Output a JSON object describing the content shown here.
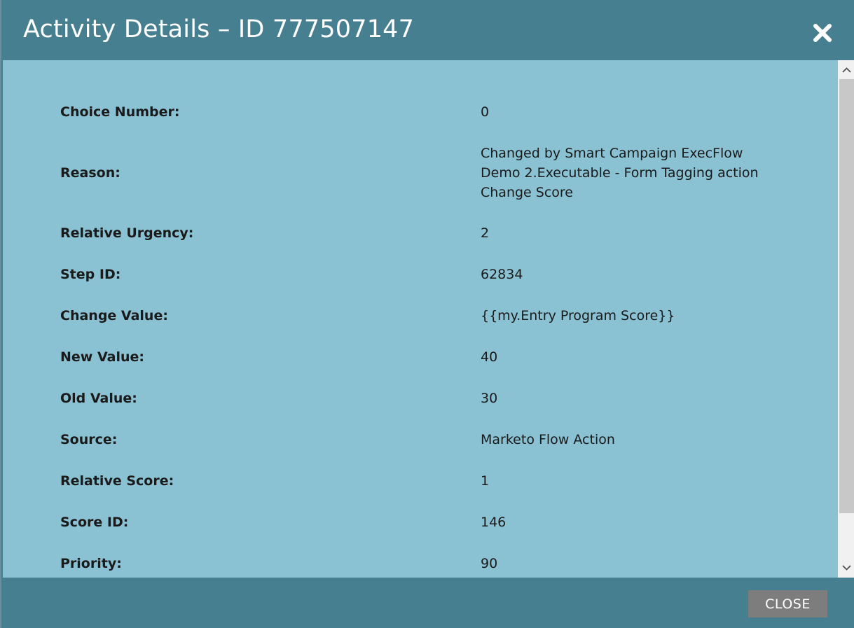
{
  "dialog": {
    "title": "Activity Details – ID 777507147",
    "close_label": "CLOSE"
  },
  "details": [
    {
      "label": "Choice Number:",
      "value": "0"
    },
    {
      "label": "Reason:",
      "value": "Changed by Smart Campaign ExecFlow Demo 2.Executable - Form Tagging action Change Score"
    },
    {
      "label": "Relative Urgency:",
      "value": "2"
    },
    {
      "label": "Step ID:",
      "value": "62834"
    },
    {
      "label": "Change Value:",
      "value": "{{my.Entry Program Score}}"
    },
    {
      "label": "New Value:",
      "value": "40"
    },
    {
      "label": "Old Value:",
      "value": "30"
    },
    {
      "label": "Source:",
      "value": "Marketo Flow Action"
    },
    {
      "label": "Relative Score:",
      "value": "1"
    },
    {
      "label": "Score ID:",
      "value": "146"
    },
    {
      "label": "Priority:",
      "value": "90"
    }
  ]
}
